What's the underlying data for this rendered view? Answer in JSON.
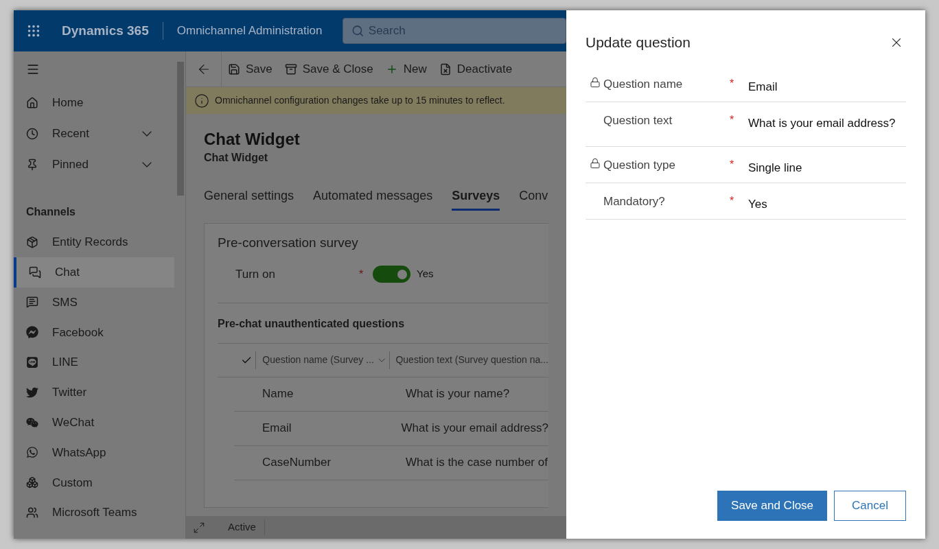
{
  "header": {
    "app_name": "Dynamics 365",
    "area": "Omnichannel Administration",
    "search": {
      "placeholder": "Search"
    }
  },
  "sidebar": {
    "nav": [
      {
        "label": "Home",
        "expandable": false
      },
      {
        "label": "Recent",
        "expandable": true
      },
      {
        "label": "Pinned",
        "expandable": true
      }
    ],
    "section_title": "Channels",
    "channels": [
      {
        "label": "Entity Records",
        "selected": false
      },
      {
        "label": "Chat",
        "selected": true
      },
      {
        "label": "SMS",
        "selected": false
      },
      {
        "label": "Facebook",
        "selected": false
      },
      {
        "label": "LINE",
        "selected": false
      },
      {
        "label": "Twitter",
        "selected": false
      },
      {
        "label": "WeChat",
        "selected": false
      },
      {
        "label": "WhatsApp",
        "selected": false
      },
      {
        "label": "Custom",
        "selected": false
      },
      {
        "label": "Microsoft Teams",
        "selected": false
      }
    ]
  },
  "commands": [
    "Save",
    "Save & Close",
    "New",
    "Deactivate"
  ],
  "notice": "Omnichannel configuration changes take up to 15 minutes to reflect.",
  "record": {
    "title": "Chat Widget",
    "subtitle": "Chat Widget"
  },
  "tabs": [
    {
      "label": "General settings",
      "selected": false
    },
    {
      "label": "Automated messages",
      "selected": false
    },
    {
      "label": "Surveys",
      "selected": true
    },
    {
      "label": "Conv",
      "selected": false
    }
  ],
  "survey": {
    "title": "Pre-conversation survey",
    "turn_on": {
      "label": "Turn on",
      "required_mark": "*",
      "on": true,
      "value": "Yes"
    },
    "subgrid": {
      "title": "Pre-chat unauthenticated questions",
      "columns": [
        "Question name (Survey ...",
        "Question text (Survey question na..."
      ],
      "rows": [
        [
          "Name",
          "What is your name?"
        ],
        [
          "Email",
          "What is your email address?"
        ],
        [
          "CaseNumber",
          "What is the case number of"
        ]
      ]
    }
  },
  "status_bar": {
    "status": "Active"
  },
  "dialog": {
    "title": "Update question",
    "fields": [
      {
        "label": "Question name",
        "locked": true,
        "required_mark": "*",
        "value": "Email"
      },
      {
        "label": "Question text",
        "locked": false,
        "required_mark": "*",
        "value": "What is your email address?"
      },
      {
        "label": "Question type",
        "locked": true,
        "required_mark": "*",
        "value": "Single line"
      },
      {
        "label": "Mandatory?",
        "locked": false,
        "required_mark": "*",
        "value": "Yes"
      }
    ],
    "buttons": [
      {
        "label": "Save and Close",
        "kind": "primary"
      },
      {
        "label": "Cancel",
        "kind": "secondary"
      }
    ]
  }
}
